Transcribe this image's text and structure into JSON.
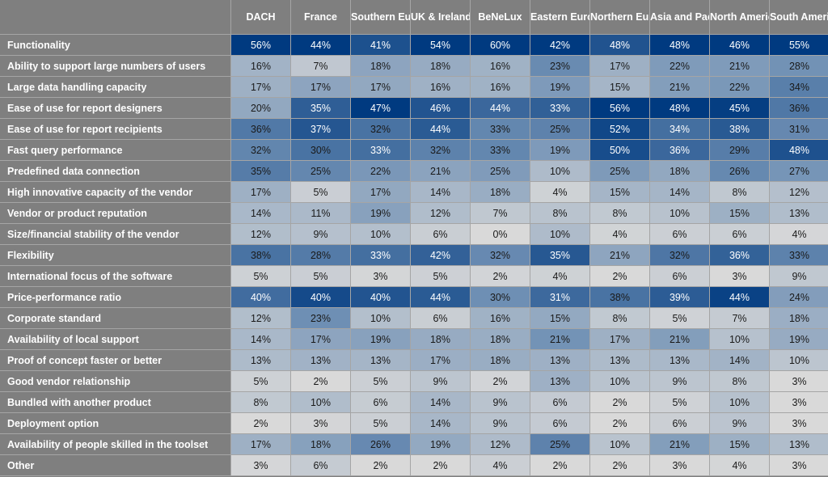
{
  "chart_data": {
    "type": "heatmap",
    "title": "",
    "color_scale": {
      "mode": "per-column",
      "low": "#d9d9d9",
      "mid": "#6e8fb4",
      "high": "#003a80"
    },
    "columns": [
      "DACH",
      "France",
      "Southern Europe",
      "UK & Ireland",
      "BeNeLux",
      "Eastern Europe",
      "Northern Europe",
      "Asia and Pacific",
      "North America",
      "South America"
    ],
    "rows": [
      {
        "label": "Functionality",
        "values": [
          56,
          44,
          41,
          54,
          60,
          42,
          48,
          48,
          46,
          55
        ]
      },
      {
        "label": "Ability to support large numbers of users",
        "values": [
          16,
          7,
          18,
          18,
          16,
          23,
          17,
          22,
          21,
          28
        ]
      },
      {
        "label": "Large data handling capacity",
        "values": [
          17,
          17,
          17,
          16,
          16,
          19,
          15,
          21,
          22,
          34
        ]
      },
      {
        "label": "Ease of use for report designers",
        "values": [
          20,
          35,
          47,
          46,
          44,
          33,
          56,
          48,
          45,
          36
        ]
      },
      {
        "label": "Ease of use for report recipients",
        "values": [
          36,
          37,
          32,
          44,
          33,
          25,
          52,
          34,
          38,
          31
        ]
      },
      {
        "label": "Fast query performance",
        "values": [
          32,
          30,
          33,
          32,
          33,
          19,
          50,
          36,
          29,
          48
        ]
      },
      {
        "label": "Predefined data connection",
        "values": [
          35,
          25,
          22,
          21,
          25,
          10,
          25,
          18,
          26,
          27
        ]
      },
      {
        "label": "High innovative capacity of the vendor",
        "values": [
          17,
          5,
          17,
          14,
          18,
          4,
          15,
          14,
          8,
          12
        ]
      },
      {
        "label": "Vendor or product reputation",
        "values": [
          14,
          11,
          19,
          12,
          7,
          8,
          8,
          10,
          15,
          13
        ]
      },
      {
        "label": "Size/financial stability of the vendor",
        "values": [
          12,
          9,
          10,
          6,
          0,
          10,
          4,
          6,
          6,
          4
        ]
      },
      {
        "label": "Flexibility",
        "values": [
          38,
          28,
          33,
          42,
          32,
          35,
          21,
          32,
          36,
          33
        ]
      },
      {
        "label": "International focus of the software",
        "values": [
          5,
          5,
          3,
          5,
          2,
          4,
          2,
          6,
          3,
          9
        ]
      },
      {
        "label": "Price-performance ratio",
        "values": [
          40,
          40,
          40,
          44,
          30,
          31,
          38,
          39,
          44,
          24
        ]
      },
      {
        "label": "Corporate standard",
        "values": [
          12,
          23,
          10,
          6,
          16,
          15,
          8,
          5,
          7,
          18
        ]
      },
      {
        "label": "Availability of local support",
        "values": [
          14,
          17,
          19,
          18,
          18,
          21,
          17,
          21,
          10,
          19
        ]
      },
      {
        "label": "Proof of concept faster or better",
        "values": [
          13,
          13,
          13,
          17,
          18,
          13,
          13,
          13,
          14,
          10
        ]
      },
      {
        "label": "Good vendor relationship",
        "values": [
          5,
          2,
          5,
          9,
          2,
          13,
          10,
          9,
          8,
          3
        ]
      },
      {
        "label": "Bundled with another product",
        "values": [
          8,
          10,
          6,
          14,
          9,
          6,
          2,
          5,
          10,
          3
        ]
      },
      {
        "label": "Deployment option",
        "values": [
          2,
          3,
          5,
          14,
          9,
          6,
          2,
          6,
          9,
          3
        ]
      },
      {
        "label": "Availability of people skilled in the toolset",
        "values": [
          17,
          18,
          26,
          19,
          12,
          25,
          10,
          21,
          15,
          13
        ]
      },
      {
        "label": "Other",
        "values": [
          3,
          6,
          2,
          2,
          4,
          2,
          2,
          3,
          4,
          3
        ]
      }
    ],
    "value_suffix": "%"
  }
}
